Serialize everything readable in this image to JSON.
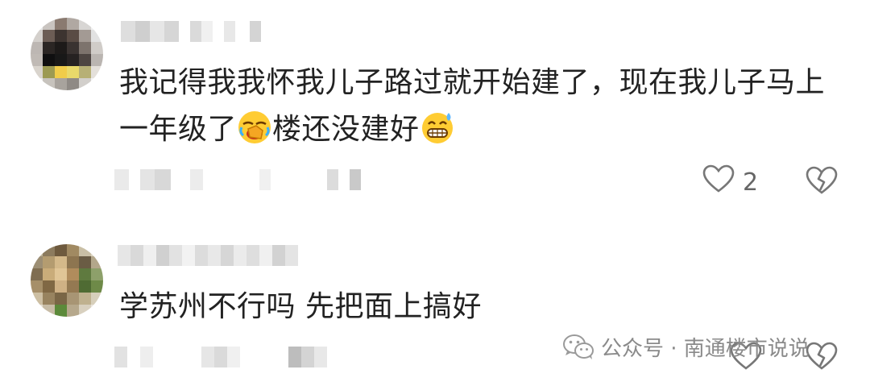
{
  "comments": [
    {
      "text_line1": "我记得我我怀我儿子路过就开始建了，现在我儿子马上",
      "text_line2_a": "一年级了",
      "text_line2_b": "楼还没建好",
      "emoji_1": "face-with-hand-over-mouth-laughing",
      "emoji_2": "grinning-face-with-sweat",
      "likes": "2",
      "like_icon": "heart-outline-icon",
      "dislike_icon": "broken-heart-outline-icon"
    },
    {
      "text_line1": "学苏州不行吗 先把面上搞好",
      "likes": "",
      "like_icon": "heart-outline-icon",
      "dislike_icon": "broken-heart-outline-icon"
    }
  ],
  "watermark": {
    "icon": "wechat-icon",
    "text": "公众号 · 南通楼市说说"
  }
}
